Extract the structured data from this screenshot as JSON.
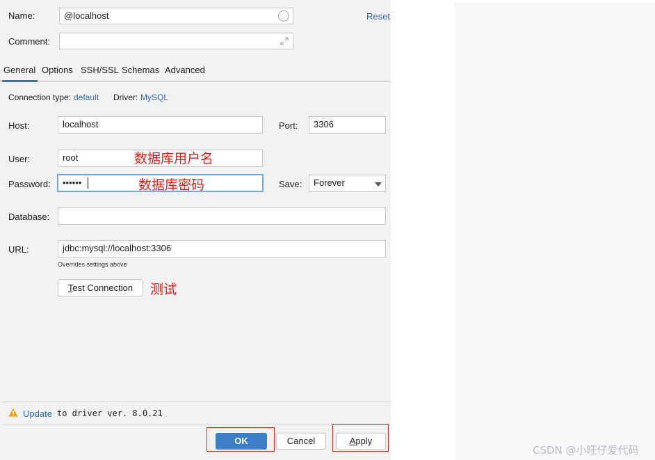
{
  "form": {
    "name_label": "Name:",
    "name_value": "@localhost",
    "reset_label": "Reset",
    "comment_label": "Comment:",
    "comment_value": ""
  },
  "tabs": [
    {
      "label": "General",
      "active": true
    },
    {
      "label": "Options",
      "active": false
    },
    {
      "label": "SSH/SSL",
      "active": false
    },
    {
      "label": "Schemas",
      "active": false
    },
    {
      "label": "Advanced",
      "active": false
    }
  ],
  "general": {
    "connection_type_label": "Connection type:",
    "connection_type_value": "default",
    "driver_label": "Driver:",
    "driver_value": "MySQL",
    "host_label": "Host:",
    "host_value": "localhost",
    "port_label": "Port:",
    "port_value": "3306",
    "user_label": "User:",
    "user_value": "root",
    "password_label": "Password:",
    "password_value": "••••••",
    "save_label": "Save:",
    "save_value": "Forever",
    "database_label": "Database:",
    "database_value": "",
    "url_label": "URL:",
    "url_value": "jdbc:mysql://localhost:3306",
    "url_hint": "Overrides settings above",
    "test_connection_label": "Test Connection",
    "test_connection_mnemonic": "T",
    "test_connection_rest": "est Connection"
  },
  "annotations": {
    "user": "数据库用户名",
    "password": "数据库密码",
    "test": "测试"
  },
  "footer": {
    "update_link": "Update",
    "update_text": "to driver ver. 8.0.21",
    "ok_label": "OK",
    "cancel_label": "Cancel",
    "apply_label": "Apply",
    "apply_mnemonic": "A",
    "apply_rest": "pply"
  },
  "watermark": "CSDN @小旺仔爱代码",
  "colors": {
    "accent": "#2f6bb5",
    "ok_button": "#3d7fc6",
    "annotation_red": "#e0201b",
    "focus_border": "#7aa6e0",
    "warning": "#e5a50a"
  }
}
